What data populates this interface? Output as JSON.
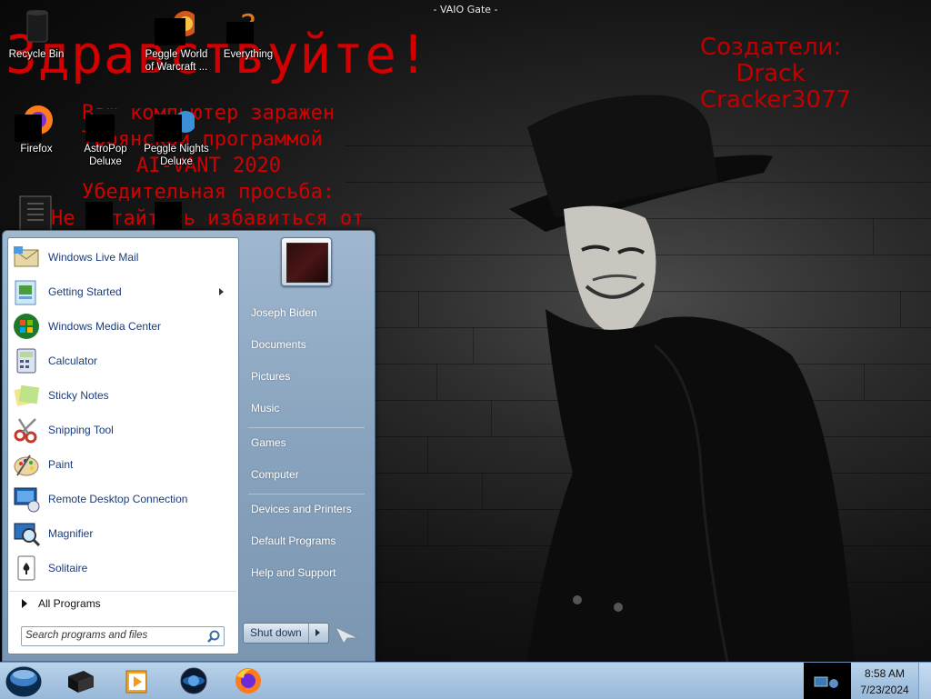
{
  "wallpaper": {
    "title": "- VAIO Gate -",
    "ransom_greeting": "Здравствуйте!",
    "ransom_lines": [
      "Ваш компьютер заражен",
      "Троянской программой",
      "AI-VANT 2020",
      "Убедительная просьба:",
      "Не пытайтесь избавиться от"
    ],
    "credits": [
      "Создатели:",
      "Drack",
      "Cracker3077"
    ]
  },
  "desktop_icons": [
    {
      "label": "Recycle Bin",
      "icon": "recycle-bin-icon"
    },
    {
      "label": "Peggle World of Warcraft ...",
      "icon": "peggle-wow-icon"
    },
    {
      "label": "Everything",
      "icon": "everything-search-icon"
    },
    {
      "label": "Firefox",
      "icon": "firefox-icon"
    },
    {
      "label": "AstroPop Deluxe",
      "icon": "astropop-icon"
    },
    {
      "label": "Peggle Nights Deluxe",
      "icon": "peggle-nights-icon"
    }
  ],
  "start_menu": {
    "programs": [
      {
        "label": "Windows Live Mail",
        "icon": "mail-icon",
        "has_submenu": false
      },
      {
        "label": "Getting Started",
        "icon": "getting-started-icon",
        "has_submenu": true
      },
      {
        "label": "Windows Media Center",
        "icon": "media-center-icon",
        "has_submenu": false
      },
      {
        "label": "Calculator",
        "icon": "calculator-icon",
        "has_submenu": false
      },
      {
        "label": "Sticky Notes",
        "icon": "sticky-notes-icon",
        "has_submenu": false
      },
      {
        "label": "Snipping Tool",
        "icon": "scissors-icon",
        "has_submenu": false
      },
      {
        "label": "Paint",
        "icon": "paint-palette-icon",
        "has_submenu": false
      },
      {
        "label": "Remote Desktop Connection",
        "icon": "remote-desktop-icon",
        "has_submenu": false
      },
      {
        "label": "Magnifier",
        "icon": "magnifier-icon",
        "has_submenu": false
      },
      {
        "label": "Solitaire",
        "icon": "cards-icon",
        "has_submenu": false
      }
    ],
    "all_programs": "All Programs",
    "search_placeholder": "Search programs and files",
    "right_links": [
      "Joseph Biden",
      "Documents",
      "Pictures",
      "Music",
      "Games",
      "Computer",
      "Devices and Printers",
      "Default Programs",
      "Help and Support"
    ],
    "shutdown_label": "Shut down"
  },
  "taskbar": {
    "pinned": [
      "file-manager-icon",
      "media-player-icon",
      "globe-icon",
      "firefox-icon"
    ],
    "clock_time": "8:58 AM",
    "clock_date": "7/23/2024"
  },
  "colors": {
    "ransom_red": "#d20000",
    "menu_link_blue": "#1a3b7a",
    "taskbar": "#a9c6e2"
  }
}
